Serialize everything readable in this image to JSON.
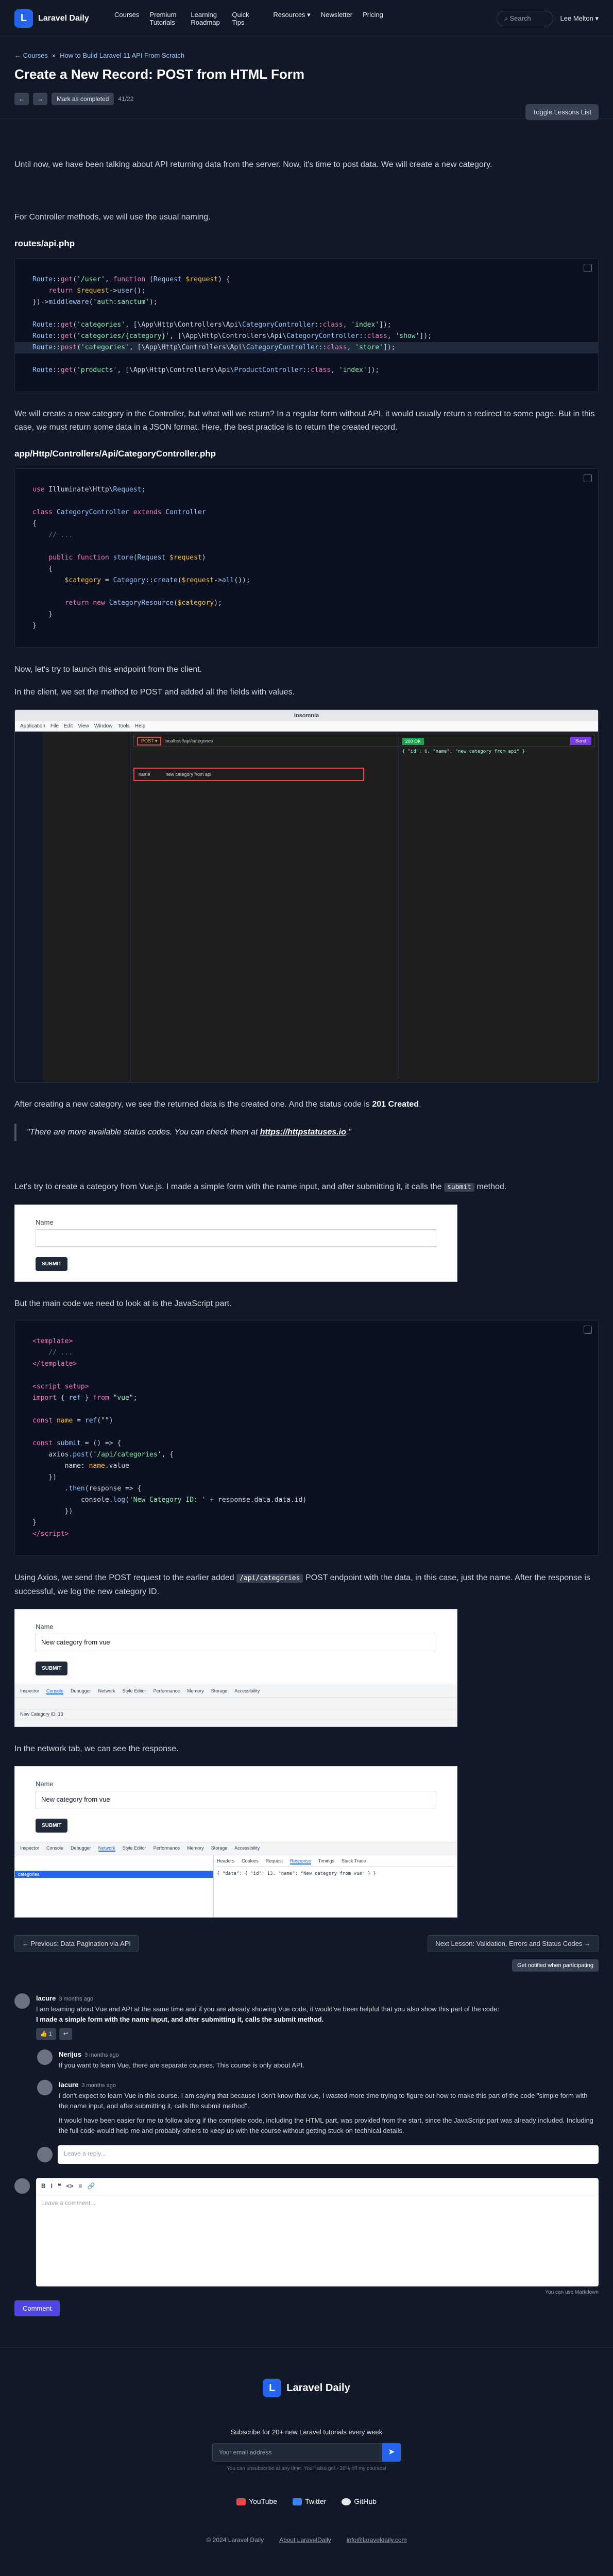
{
  "nav": {
    "brand": "Laravel Daily",
    "items": [
      "Courses",
      "Premium Tutorials",
      "Learning Roadmap",
      "Quick Tips",
      "Resources ▾",
      "Newsletter",
      "Pricing"
    ],
    "search": "Search",
    "user": "Lee Melton ▾"
  },
  "hero": {
    "back": "← Courses",
    "crumb": "How to Build Laravel 11 API From Scratch",
    "title": "Create a New Record: POST from HTML Form",
    "toggle": "Toggle Lessons List",
    "mark": "Mark as completed",
    "count": "41/22"
  },
  "p1": "Until now, we have been talking about API returning data from the server. Now, it's time to post data. We will create a new category.",
  "p2": "For Controller methods, we will use the usual naming.",
  "file1": "routes/api.php",
  "p3": "We will create a new category in the Controller, but what will we return? In a regular form without API, it would usually return a redirect to some page. But in this case, we must return some data in a JSON format. Here, the best practice is to return the created record.",
  "file2": "app/Http/Controllers/Api/CategoryController.php",
  "p4": "Now, let's try to launch this endpoint from the client.",
  "p5": "In the client, we set the method to POST and added all the fields with values.",
  "insomnia": {
    "title": "Insomnia",
    "menu": [
      "Application",
      "File",
      "Edit",
      "View",
      "Window",
      "Tools",
      "Help"
    ],
    "method": "POST ▾",
    "url": "localhost/api/categories",
    "send": "Send",
    "field": "name",
    "value": "new category from api",
    "status": "200 OK",
    "resp": "{ \"id\": 6, \"name\": \"new category from api\" }"
  },
  "p6a": "After creating a new category, we see the returned data is the created one. And the status code is ",
  "p6b": "201 Created",
  "quote_a": "\"There are more available status codes. You can check them at ",
  "quote_link": "https://httpstatuses.io",
  "quote_b": ".\"",
  "p7a": "Let's try to create a category from Vue.js. I made a simple form with the name input, and after submitting it, it calls the ",
  "p7code": "submit",
  "p7b": " method.",
  "form1": {
    "label": "Name",
    "btn": "SUBMIT"
  },
  "p8": "But the main code we need to look at is the JavaScript part.",
  "p9a": "Using Axios, we send the POST request to the earlier added ",
  "p9code": "/api/categories",
  "p9b": " POST endpoint with the data, in this case, just the name. After the response is successful, we log the new category ID.",
  "form2": {
    "label": "Name",
    "value": "New category from vue",
    "btn": "SUBMIT",
    "tabs": [
      "Inspector",
      "Console",
      "Debugger",
      "Network",
      "Style Editor",
      "Performance",
      "Memory",
      "Storage",
      "Accessibility"
    ],
    "log": "New Category ID: 13"
  },
  "p10": "In the network tab, we can see the response.",
  "form3": {
    "label": "Name",
    "value": "New category from vue",
    "btn": "SUBMIT",
    "tabs": [
      "Inspector",
      "Console",
      "Debugger",
      "Network",
      "Style Editor",
      "Performance",
      "Memory",
      "Storage",
      "Accessibility"
    ],
    "req": "categories",
    "detail": [
      "Headers",
      "Cookies",
      "Request",
      "Response",
      "Timings",
      "Stack Trace"
    ],
    "resp": "{ \"data\": { \"id\": 13, \"name\": \"New category from vue\" } }"
  },
  "pager": {
    "prev": "← Previous: Data Pagination via API",
    "next": "Next Lesson: Validation, Errors and Status Codes →",
    "notify": "Get notified when participating"
  },
  "comments": [
    {
      "who": "lacure",
      "when": "3 months ago",
      "text": "I am learning about Vue and API at the same time and if you are already showing Vue code, it would've been helpful that you also show this part of the code:",
      "bold": "I made a simple form with the name input, and after submitting it, calls the submit method."
    },
    {
      "who": "Nerijus",
      "when": "3 months ago",
      "text": "If you want to learn Vue, there are separate courses. This course is only about API."
    },
    {
      "who": "lacure",
      "when": "3 months ago",
      "text": "I don't expect to learn Vue in this course. I am saying that because I don't know that vue, I wasted more time trying to figure out how to make this part of the code \"simple form with the name input, and after submitting it, calls the submit method\".",
      "text2": "It would have been easier for me to follow along if the complete code, including the HTML part, was provided from the start, since the JavaScript part was already included. Including the full code would help me and probably others to keep up with the course without getting stuck on technical details."
    }
  ],
  "reply_ph": "Leave a reply...",
  "comment_ph": "Leave a comment...",
  "md_hint": "You can use Markdown",
  "comment_btn": "Comment",
  "footer": {
    "brand": "Laravel Daily",
    "sub": "Subscribe for 20+ new Laravel tutorials every week",
    "email_ph": "Your email address",
    "note": "You can unsubscribe at any time. You'll also get - 20% off my courses!",
    "social": [
      "YouTube",
      "Twitter",
      "GitHub"
    ],
    "copy": "© 2024 Laravel Daily",
    "about": "About LaravelDaily",
    "mail": "info@laraveldaily.com"
  }
}
